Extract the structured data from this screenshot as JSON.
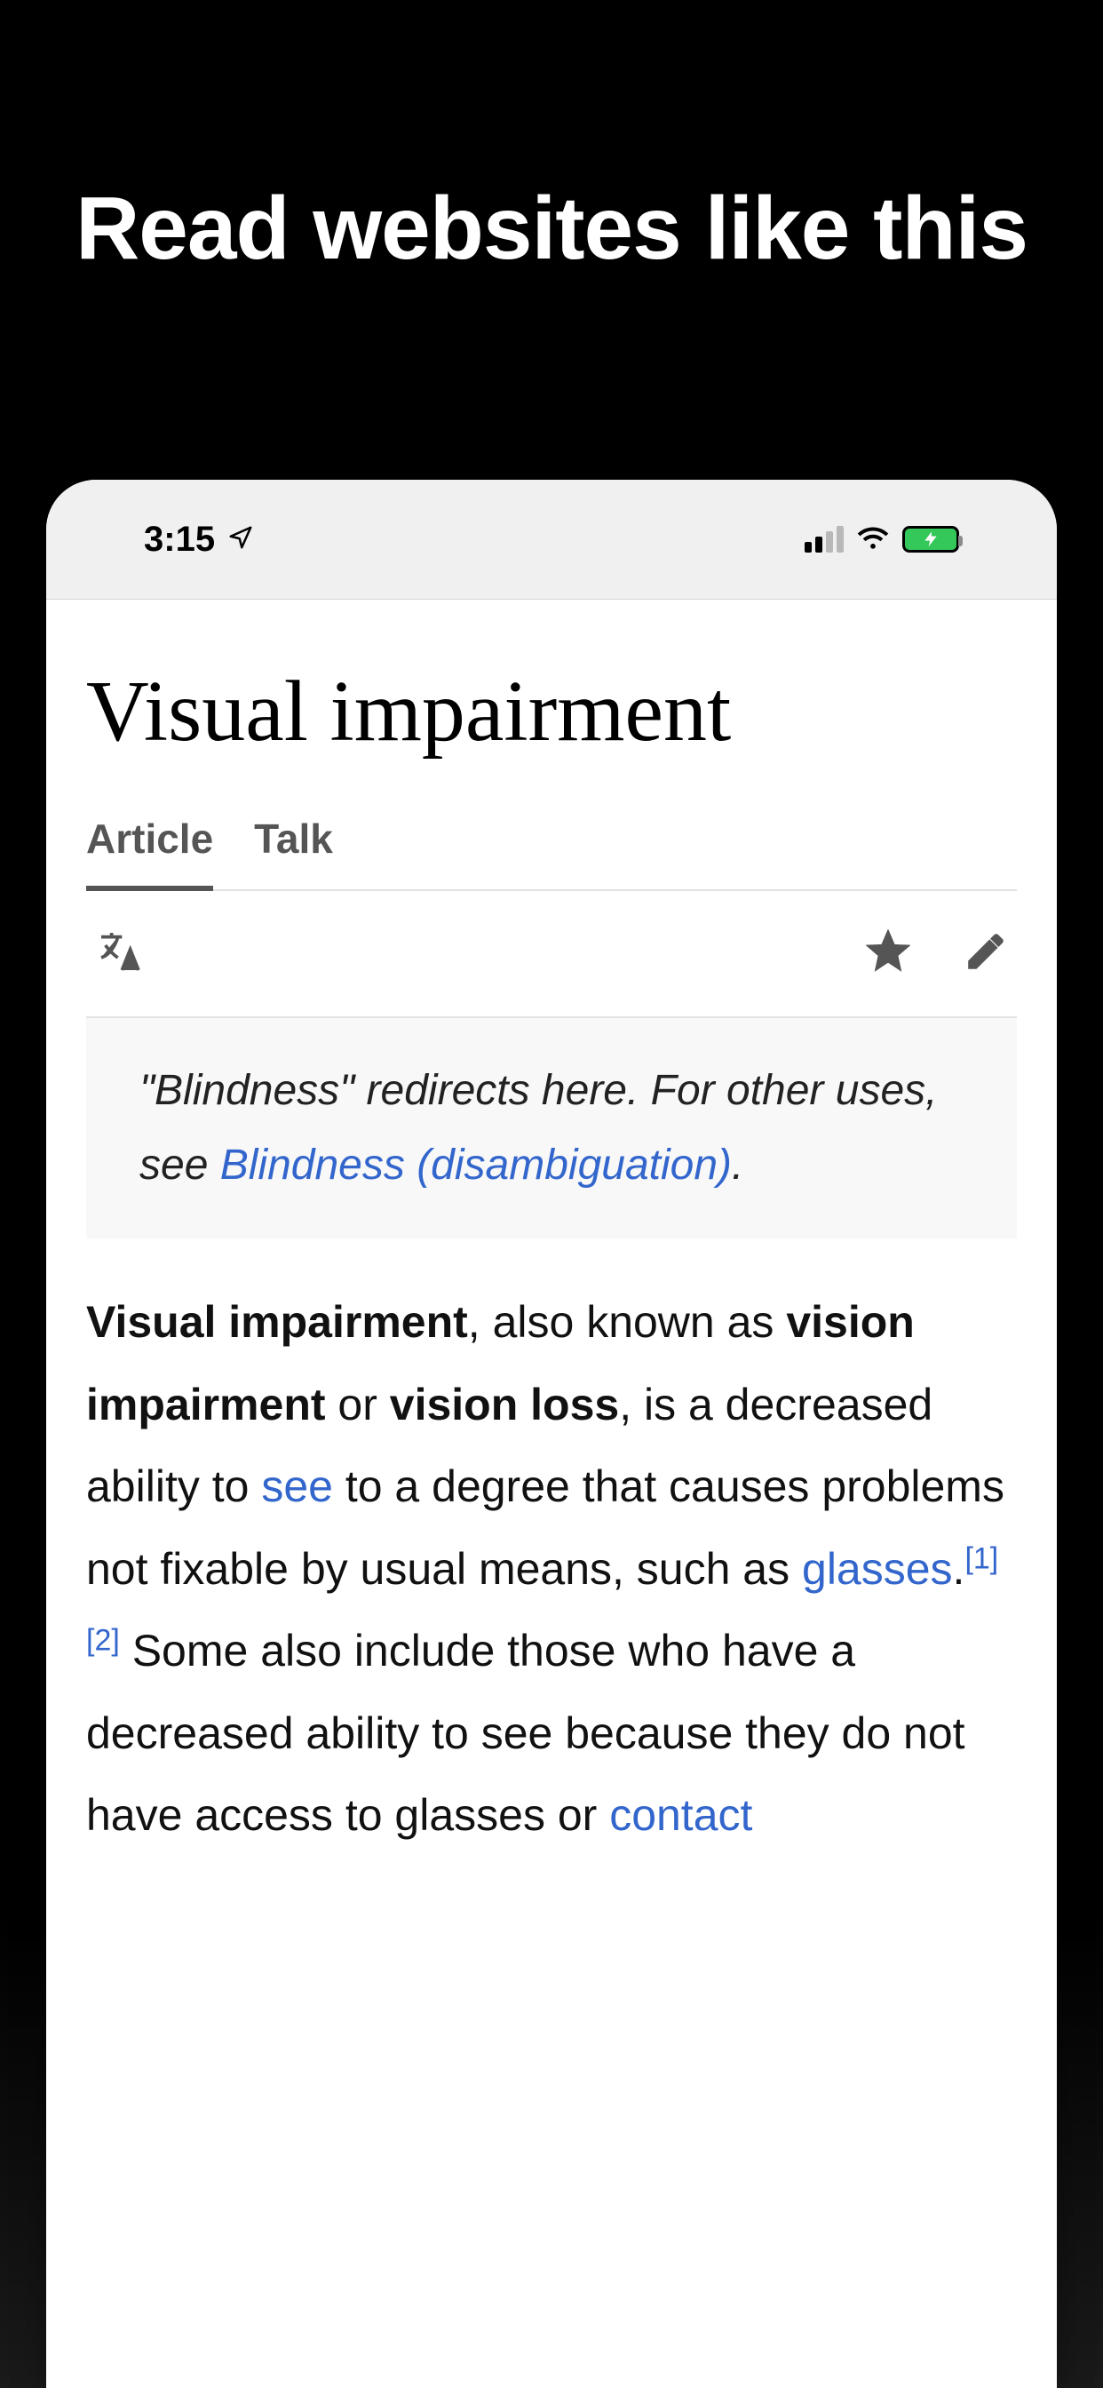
{
  "headline": "Read websites like this",
  "status": {
    "time": "3:15"
  },
  "page": {
    "title": "Visual impairment",
    "tabs": {
      "article": "Article",
      "talk": "Talk"
    },
    "hatnote": {
      "prefix": "\"Blindness\" redirects here. For other uses, see ",
      "link": "Blindness (disambiguation)",
      "suffix": "."
    },
    "body": {
      "b1": "Visual impairment",
      "t1": ", also known as ",
      "b2": "vision impairment",
      "t2": " or ",
      "b3": "vision loss",
      "t3": ", is a decreased ability to ",
      "link_see": "see",
      "t4": " to a degree that causes problems not fixable by usual means, such as ",
      "link_glasses": "glasses",
      "t5": ".",
      "ref1": "[1]",
      "ref2": "[2]",
      "t6": " Some also include those who have a decreased ability to see because they do not have access to glasses or ",
      "link_contact": "contact"
    }
  }
}
